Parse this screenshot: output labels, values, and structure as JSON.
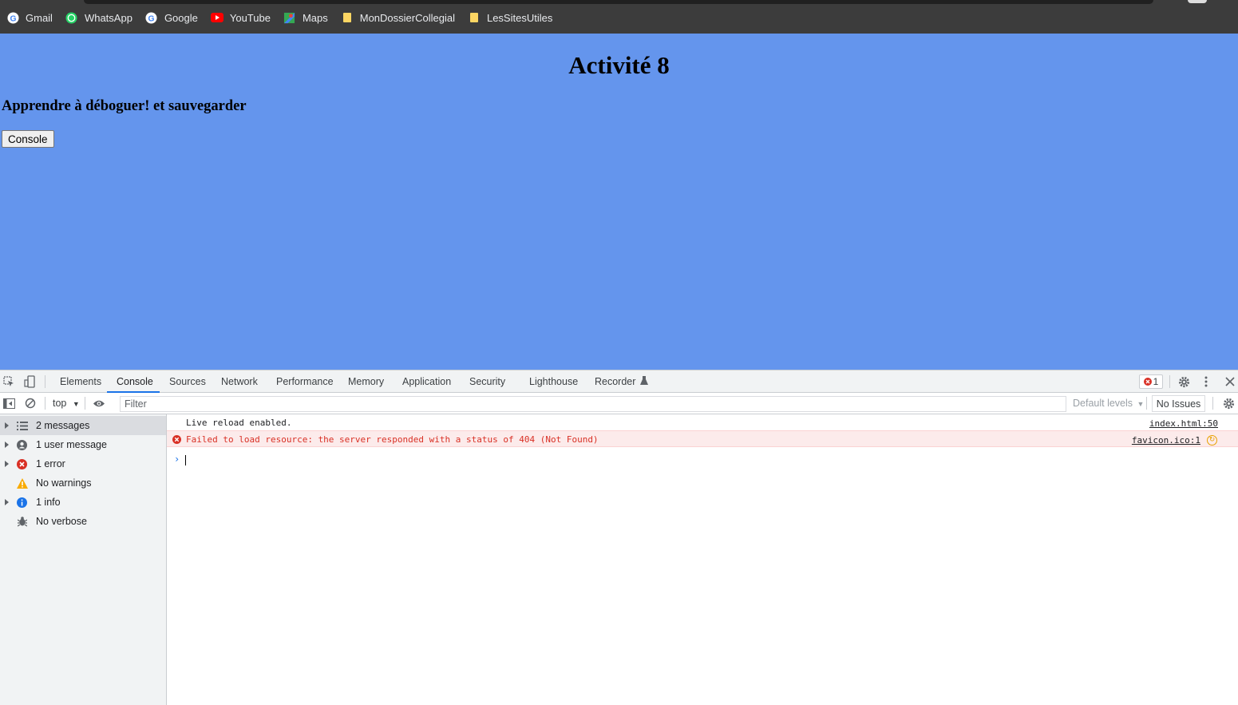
{
  "bookmarks": [
    {
      "label": "Gmail",
      "icon": "google-icon"
    },
    {
      "label": "WhatsApp",
      "icon": "whatsapp-icon"
    },
    {
      "label": "Google",
      "icon": "google-icon"
    },
    {
      "label": "YouTube",
      "icon": "youtube-icon"
    },
    {
      "label": "Maps",
      "icon": "maps-icon"
    },
    {
      "label": "MonDossierCollegial",
      "icon": "folder-icon"
    },
    {
      "label": "LesSitesUtiles",
      "icon": "folder-icon"
    }
  ],
  "page": {
    "title": "Activité 8",
    "subtitle": "Apprendre à déboguer! et sauvegarder",
    "button_label": "Console",
    "background": "#6495ed"
  },
  "devtools": {
    "tabs": [
      "Elements",
      "Console",
      "Sources",
      "Network",
      "Performance",
      "Memory",
      "Application",
      "Security",
      "Lighthouse",
      "Recorder"
    ],
    "active_tab": "Console",
    "error_count": "1",
    "toolbar": {
      "context": "top",
      "filter_placeholder": "Filter",
      "levels": "Default levels",
      "issues": "No Issues"
    },
    "sidebar": [
      {
        "label": "2 messages",
        "icon": "list-icon"
      },
      {
        "label": "1 user message",
        "icon": "user-icon"
      },
      {
        "label": "1 error",
        "icon": "error-icon"
      },
      {
        "label": "No warnings",
        "icon": "warning-icon"
      },
      {
        "label": "1 info",
        "icon": "info-icon"
      },
      {
        "label": "No verbose",
        "icon": "bug-icon"
      }
    ],
    "messages": [
      {
        "type": "log",
        "text": "Live reload enabled.",
        "source": "index.html:50"
      },
      {
        "type": "error",
        "text": "Failed to load resource: the server responded with a status of 404 (Not Found)",
        "source": "favicon.ico:1"
      }
    ]
  }
}
